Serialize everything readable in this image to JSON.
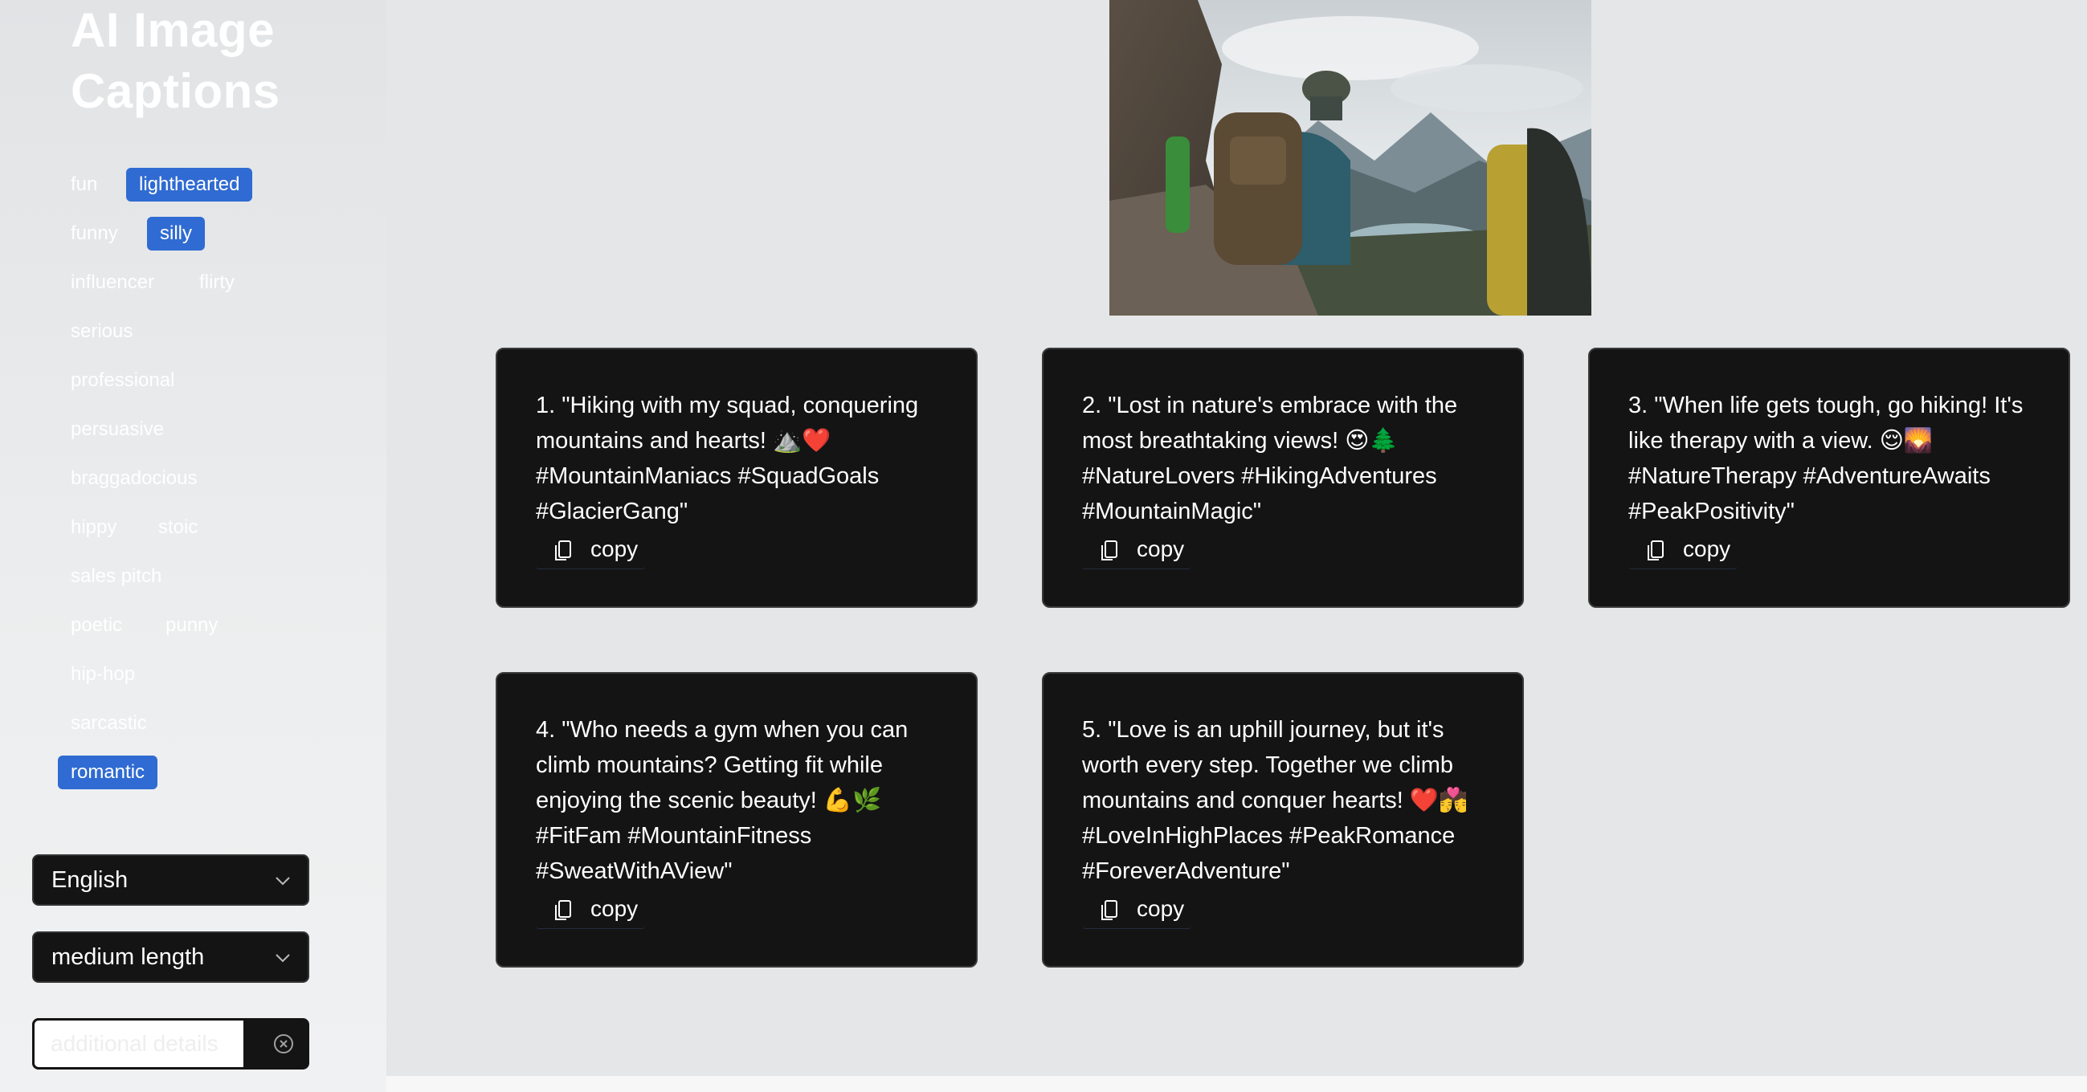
{
  "sidebar": {
    "title": "AI Image Captions",
    "tags": [
      {
        "label": "fun",
        "active": false
      },
      {
        "label": "lighthearted",
        "active": true
      },
      {
        "label": "funny",
        "active": false
      },
      {
        "label": "silly",
        "active": true
      },
      {
        "label": "influencer",
        "active": false
      },
      {
        "label": "flirty",
        "active": false
      },
      {
        "label": "serious",
        "active": false
      },
      {
        "label": "professional",
        "active": false
      },
      {
        "label": "persuasive",
        "active": false
      },
      {
        "label": "braggadocious",
        "active": false
      },
      {
        "label": "hippy",
        "active": false
      },
      {
        "label": "stoic",
        "active": false
      },
      {
        "label": "sales pitch",
        "active": false
      },
      {
        "label": "poetic",
        "active": false
      },
      {
        "label": "punny",
        "active": false
      },
      {
        "label": "hip-hop",
        "active": false
      },
      {
        "label": "sarcastic",
        "active": false
      },
      {
        "label": "romantic",
        "active": true
      }
    ],
    "language_select": {
      "value": "English",
      "icon": "chevron-down-icon"
    },
    "length_select": {
      "value": "medium length",
      "icon": "chevron-down-icon"
    },
    "details_input": {
      "placeholder": "additional details",
      "value": "",
      "clear_icon": "clear-x-icon"
    }
  },
  "main": {
    "image": {
      "subject": "hiker with backpack overlooking mountain lake"
    },
    "copy_label": "copy",
    "copy_icon": "copy-icon",
    "captions": [
      {
        "text": "1. \"Hiking with my squad, conquering mountains and hearts! ⛰️❤️ #MountainManiacs #SquadGoals #GlacierGang\""
      },
      {
        "text": "2. \"Lost in nature's embrace with the most breathtaking views! 😍🌲 #NatureLovers #HikingAdventures #MountainMagic\""
      },
      {
        "text": "3. \"When life gets tough, go hiking! It's like therapy with a view. 😌🌄 #NatureTherapy #AdventureAwaits #PeakPositivity\""
      },
      {
        "text": "4. \"Who needs a gym when you can climb mountains? Getting fit while enjoying the scenic beauty! 💪🌿 #FitFam #MountainFitness #SweatWithAView\""
      },
      {
        "text": "5. \"Love is an uphill journey, but it's worth every step. Together we climb mountains and conquer hearts! ❤️💏 #LoveInHighPlaces #PeakRomance #ForeverAdventure\""
      }
    ]
  },
  "colors": {
    "accent": "#2f6bd2",
    "card_bg": "#141414",
    "sidebar_bg": "#e3e5e7",
    "main_bg": "#e5e6e7"
  }
}
